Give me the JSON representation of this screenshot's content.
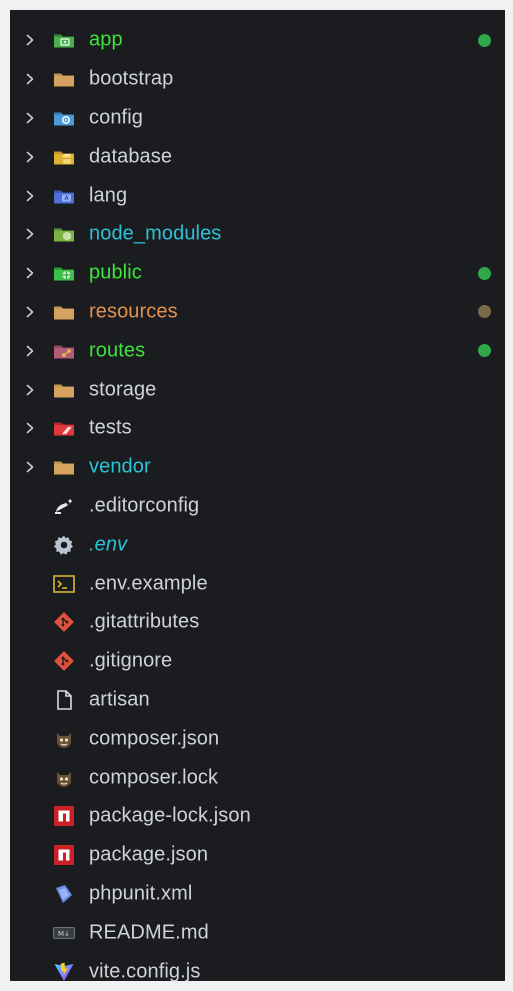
{
  "colors": {
    "background": "#1b1c1f",
    "text_default": "#cfd3d8",
    "text_git_added": "#3ee43a",
    "text_ignored": "#2bc3d8",
    "text_modified": "#e2924e",
    "dot_green": "#2fa84a",
    "dot_brown": "#7a6a4a"
  },
  "items": [
    {
      "label": "app",
      "kind": "folder",
      "icon": "folder-app-icon",
      "color": "green",
      "dot": "dot_green"
    },
    {
      "label": "bootstrap",
      "kind": "folder",
      "icon": "folder-icon",
      "color": "default"
    },
    {
      "label": "config",
      "kind": "folder",
      "icon": "folder-config-icon",
      "color": "default"
    },
    {
      "label": "database",
      "kind": "folder",
      "icon": "folder-database-icon",
      "color": "default"
    },
    {
      "label": "lang",
      "kind": "folder",
      "icon": "folder-lang-icon",
      "color": "default"
    },
    {
      "label": "node_modules",
      "kind": "folder",
      "icon": "folder-node-icon",
      "color": "cyan"
    },
    {
      "label": "public",
      "kind": "folder",
      "icon": "folder-public-icon",
      "color": "green",
      "dot": "dot_green"
    },
    {
      "label": "resources",
      "kind": "folder",
      "icon": "folder-icon",
      "color": "orange",
      "dot": "dot_brown"
    },
    {
      "label": "routes",
      "kind": "folder",
      "icon": "folder-routes-icon",
      "color": "green",
      "dot": "dot_green"
    },
    {
      "label": "storage",
      "kind": "folder",
      "icon": "folder-icon",
      "color": "default"
    },
    {
      "label": "tests",
      "kind": "folder",
      "icon": "folder-test-icon",
      "color": "default"
    },
    {
      "label": "vendor",
      "kind": "folder",
      "icon": "folder-icon",
      "color": "cyan"
    },
    {
      "label": ".editorconfig",
      "kind": "file",
      "icon": "editorconfig-icon",
      "color": "default"
    },
    {
      "label": ".env",
      "kind": "file",
      "icon": "gear-icon",
      "color": "cyan",
      "italic": true
    },
    {
      "label": ".env.example",
      "kind": "file",
      "icon": "terminal-icon",
      "color": "default"
    },
    {
      "label": ".gitattributes",
      "kind": "file",
      "icon": "git-icon",
      "color": "default"
    },
    {
      "label": ".gitignore",
      "kind": "file",
      "icon": "git-icon",
      "color": "default"
    },
    {
      "label": "artisan",
      "kind": "file",
      "icon": "file-icon",
      "color": "default"
    },
    {
      "label": "composer.json",
      "kind": "file",
      "icon": "composer-icon",
      "color": "default"
    },
    {
      "label": "composer.lock",
      "kind": "file",
      "icon": "composer-icon",
      "color": "default"
    },
    {
      "label": "package-lock.json",
      "kind": "file",
      "icon": "npm-icon",
      "color": "default"
    },
    {
      "label": "package.json",
      "kind": "file",
      "icon": "npm-icon",
      "color": "default"
    },
    {
      "label": "phpunit.xml",
      "kind": "file",
      "icon": "phpunit-icon",
      "color": "default"
    },
    {
      "label": "README.md",
      "kind": "file",
      "icon": "markdown-icon",
      "color": "default"
    },
    {
      "label": "vite.config.js",
      "kind": "file",
      "icon": "vite-icon",
      "color": "default"
    }
  ]
}
